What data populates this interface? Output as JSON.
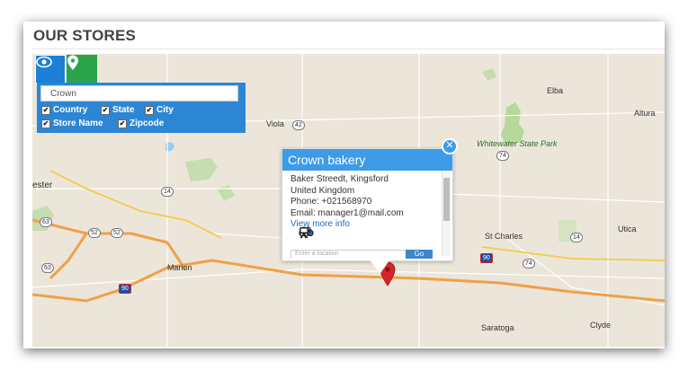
{
  "page": {
    "title": "OUR STORES"
  },
  "search": {
    "value": "Crown"
  },
  "filters": [
    {
      "label": "Country",
      "checked": true
    },
    {
      "label": "State",
      "checked": true
    },
    {
      "label": "City",
      "checked": true
    },
    {
      "label": "Store Name",
      "checked": true
    },
    {
      "label": "Zipcode",
      "checked": true
    }
  ],
  "buttons": {
    "view_icon": "eye-icon",
    "locate_icon": "location-pin-icon"
  },
  "info_window": {
    "title": "Crown bakery",
    "address": "Baker Streedt, Kingsford",
    "country": "United Kingdom",
    "phone": "Phone: +021568970",
    "email": "Email: manager1@mail.com",
    "link": "View more info",
    "modes": [
      "car-icon",
      "walking-icon",
      "bicycle-icon",
      "transit-icon"
    ],
    "close_icon": "close-icon"
  },
  "map": {
    "places": [
      "Elba",
      "Altura",
      "Viola",
      "Whitewater State Park",
      "ester",
      "Marion",
      "St Charles",
      "Utica",
      "Saratoga",
      "Clyde"
    ],
    "shields": [
      "42",
      "74",
      "14",
      "14",
      "63",
      "52",
      "52",
      "63",
      "90",
      "90",
      "74",
      "14"
    ],
    "colors": {
      "highway": "#f0a04b",
      "park": "#b7d89a",
      "water": "#9ccaf0",
      "header": "#3d9be9",
      "pin": "#d9252a"
    }
  }
}
